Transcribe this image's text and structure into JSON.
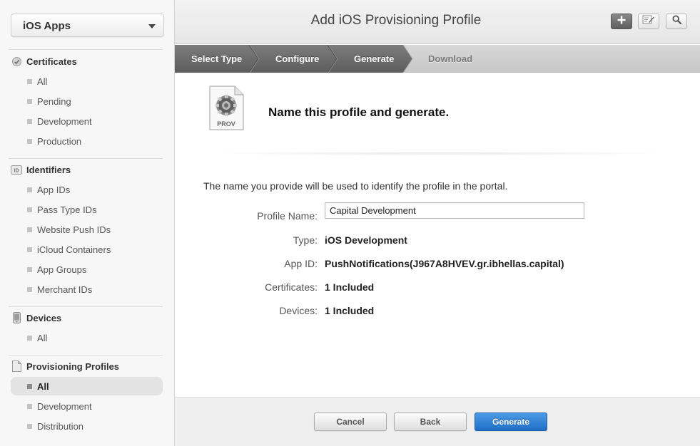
{
  "sidebar": {
    "app_select": "iOS Apps",
    "sections": [
      {
        "title": "Certificates",
        "icon": "certificate-icon",
        "items": [
          "All",
          "Pending",
          "Development",
          "Production"
        ]
      },
      {
        "title": "Identifiers",
        "icon": "id-badge-icon",
        "items": [
          "App IDs",
          "Pass Type IDs",
          "Website Push IDs",
          "iCloud Containers",
          "App Groups",
          "Merchant IDs"
        ]
      },
      {
        "title": "Devices",
        "icon": "iphone-device-icon",
        "items": [
          "All"
        ]
      },
      {
        "title": "Provisioning Profiles",
        "icon": "document-icon",
        "items": [
          "All",
          "Development",
          "Distribution"
        ],
        "active_item": "All"
      }
    ]
  },
  "header": {
    "title": "Add iOS Provisioning Profile",
    "tools": [
      "add-icon",
      "edit-icon",
      "search-icon"
    ]
  },
  "steps": {
    "items": [
      "Select Type",
      "Configure",
      "Generate",
      "Download"
    ],
    "current": "Generate"
  },
  "content": {
    "icon_label": "PROV",
    "heading": "Name this profile and generate.",
    "intro": "The name you provide will be used to identify the profile in the portal.",
    "fields": {
      "profile_name_label": "Profile Name:",
      "profile_name_value": "Capital Development",
      "type_label": "Type:",
      "type_value": "iOS Development",
      "app_id_label": "App ID:",
      "app_id_value": "PushNotifications(J967A8HVEV.gr.ibhellas.capital)",
      "certificates_label": "Certificates:",
      "certificates_value": "1 Included",
      "devices_label": "Devices:",
      "devices_value": "1 Included"
    }
  },
  "footer": {
    "cancel": "Cancel",
    "back": "Back",
    "generate": "Generate"
  },
  "colors": {
    "primary_button": "#2a7ad3",
    "step_active": "#6d6d6d",
    "step_inactive": "#cfcfcf"
  }
}
